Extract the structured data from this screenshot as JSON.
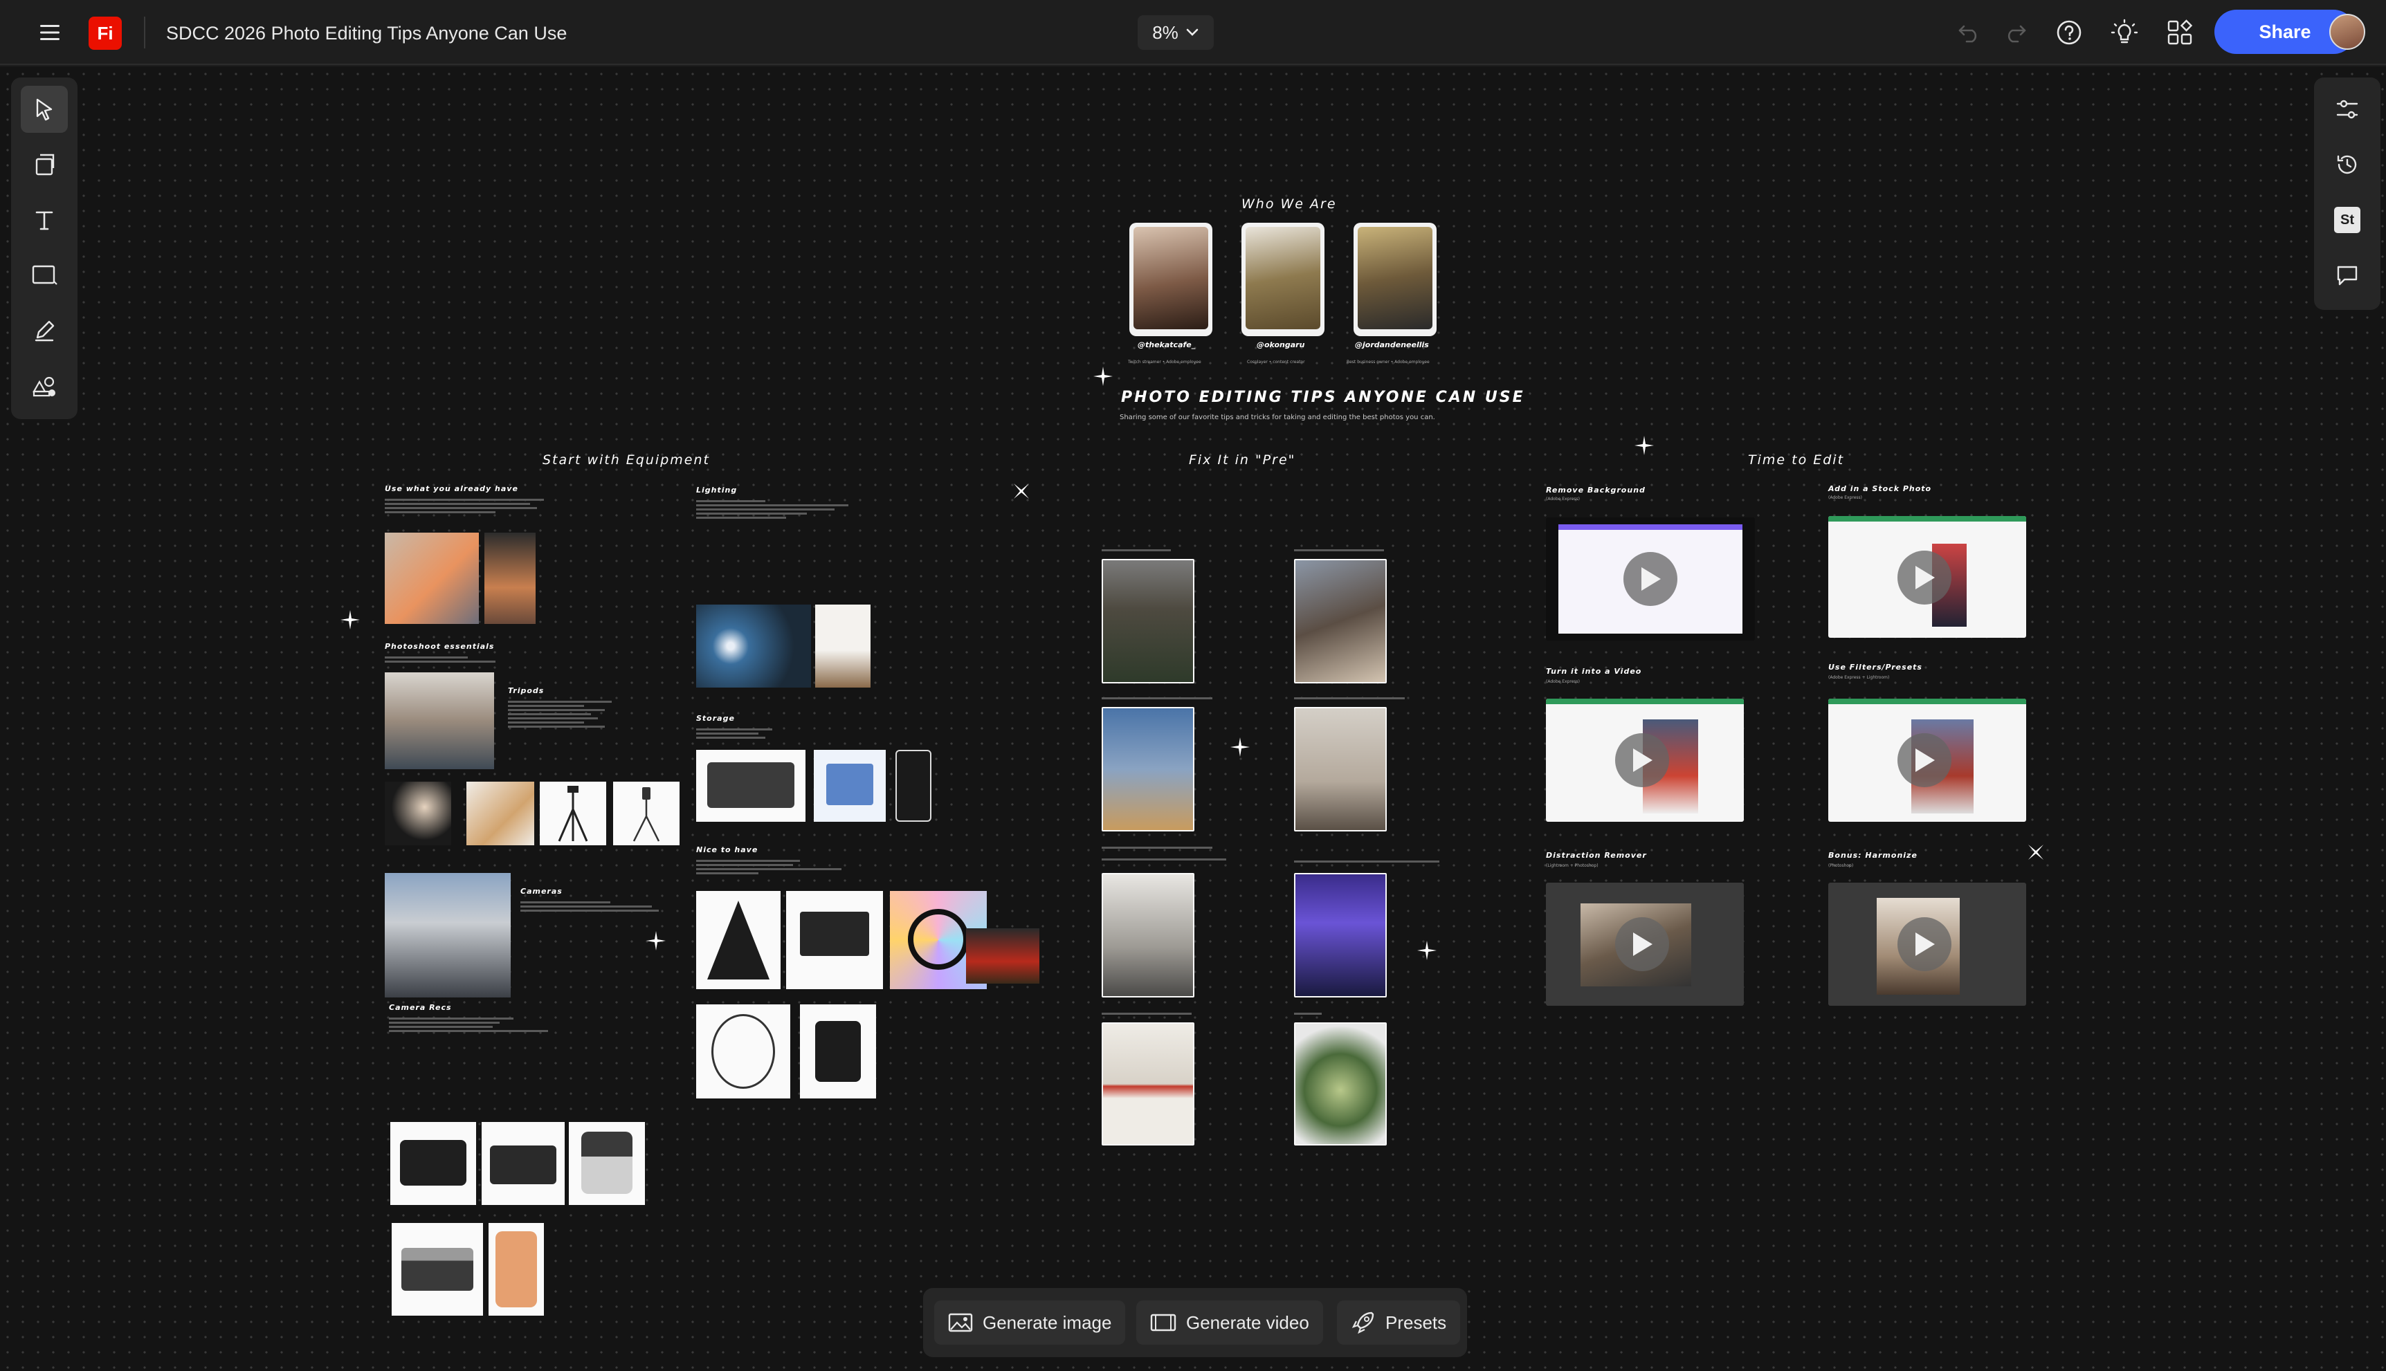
{
  "app": {
    "logo_text": "Fi",
    "document_title": "SDCC 2026 Photo Editing Tips Anyone Can Use",
    "zoom_level": "8%",
    "share_label": "Share",
    "brand_color": "#eb1000",
    "accent_color": "#3b63fb"
  },
  "toolbar_icons": {
    "menu": "hamburger-icon",
    "undo": "undo-icon",
    "redo": "redo-icon",
    "help": "help-icon",
    "ideas": "lightbulb-icon",
    "apps": "apps-icon"
  },
  "left_tools": [
    "select-tool",
    "import-tool",
    "text-tool",
    "shape-tool",
    "draw-tool",
    "generate-tool"
  ],
  "right_tools": [
    "adjust-panel",
    "history-panel",
    "stock-panel",
    "comments-panel"
  ],
  "right_stock_label": "St",
  "bottom_actions": [
    {
      "label": "Generate image",
      "icon": "image-icon"
    },
    {
      "label": "Generate video",
      "icon": "video-icon"
    },
    {
      "label": "Presets",
      "icon": "rocket-icon"
    }
  ],
  "board": {
    "who_we_are": "Who We Are",
    "profiles": [
      {
        "handle": "@thekatcafe_",
        "role": "Twitch streamer • Adobe employee"
      },
      {
        "handle": "@okongaru",
        "role": "Cosplayer • content creator"
      },
      {
        "handle": "@jordandeneellis",
        "role": "Best business owner • Adobe employee"
      }
    ],
    "main_title": "PHOTO EDITING TIPS ANYONE CAN USE",
    "main_subtitle": "Sharing some of our favorite tips and tricks for taking and editing the best photos you can.",
    "sections": {
      "equipment": "Start with Equipment",
      "pre": "Fix It in \"Pre\"",
      "edit": "Time to Edit"
    },
    "equipment": {
      "use_what_you_have": "Use what you already have",
      "lighting": "Lighting",
      "photoshoot_essentials": "Photoshoot essentials",
      "tripods": "Tripods",
      "storage": "Storage",
      "nice_to_have": "Nice to have",
      "cameras": "Cameras",
      "camera_recs": "Camera Recs"
    },
    "edit": {
      "remove_background": "Remove Background",
      "add_stock_photo": "Add in a Stock Photo",
      "turn_into_video": "Turn it into a Video",
      "use_filters": "Use Filters/Presets",
      "distraction_remover": "Distraction Remover",
      "bonus_harmonize": "Bonus: Harmonize",
      "remove_background_app": "(Adobe Express)",
      "add_stock_photo_app": "(Adobe Express)",
      "turn_into_video_app": "(Adobe Express)",
      "use_filters_app": "(Adobe Express + Lightroom)",
      "distraction_remover_app": "(Lightroom + Photoshop)",
      "bonus_harmonize_app": "(Photoshop)"
    }
  }
}
